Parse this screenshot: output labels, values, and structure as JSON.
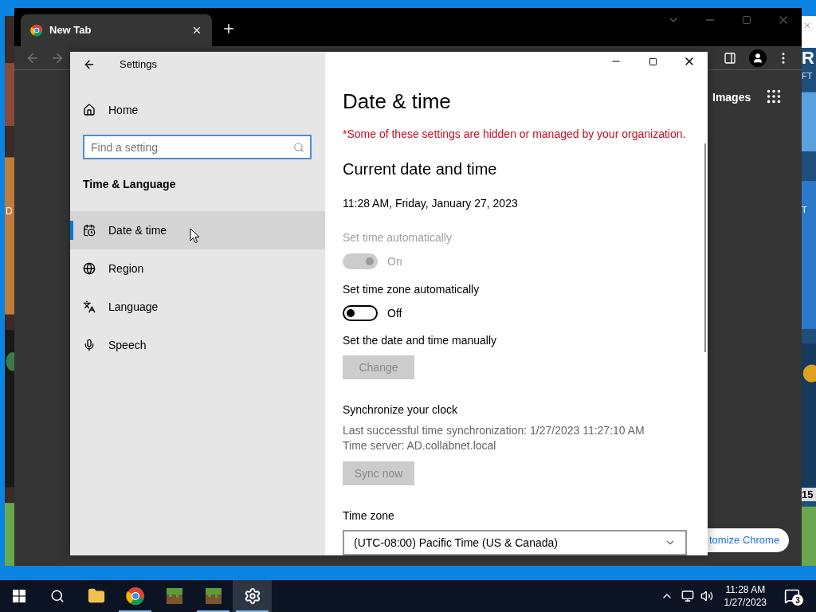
{
  "background_windows": {
    "left_texts": [
      "D"
    ],
    "right_texts": [
      "R",
      "FT",
      "T",
      "15"
    ]
  },
  "browser": {
    "tabs": [
      {
        "title": "New Tab",
        "selected": true
      }
    ],
    "page": {
      "header_link": "Images",
      "customize_button": "tomize Chrome"
    }
  },
  "settings": {
    "window_title": "Settings",
    "sidebar": {
      "home": "Home",
      "search": {
        "placeholder": "Find a setting"
      },
      "section": "Time & Language",
      "items": [
        {
          "label": "Date & time",
          "selected": true
        },
        {
          "label": "Region",
          "selected": false
        },
        {
          "label": "Language",
          "selected": false
        },
        {
          "label": "Speech",
          "selected": false
        }
      ]
    },
    "content": {
      "title": "Date & time",
      "notice": "*Some of these settings are hidden or managed by your organization.",
      "section_title": "Current date and time",
      "current": "11:28 AM, Friday, January 27, 2023",
      "rows": [
        {
          "kind": "toggle",
          "label": "Set time automatically",
          "on": true,
          "disabled": true,
          "state_text": "On"
        },
        {
          "kind": "toggle",
          "label": "Set time zone automatically",
          "on": false,
          "disabled": false,
          "state_text": "Off"
        },
        {
          "kind": "button",
          "label": "Set the date and time manually",
          "lines": [],
          "button": "Change",
          "disabled": true
        },
        {
          "kind": "button",
          "label": "Synchronize your clock",
          "lines": [
            "Last successful time synchronization: 1/27/2023 11:27:10 AM",
            "Time server: AD.collabnet.local"
          ],
          "button": "Sync now",
          "disabled": true
        },
        {
          "kind": "dropdown",
          "label": "Time zone",
          "value": "(UTC-08:00) Pacific Time (US & Canada)"
        }
      ]
    }
  },
  "taskbar": {
    "apps": [
      {
        "running": false,
        "selected": false
      },
      {
        "running": true,
        "selected": false
      },
      {
        "running": false,
        "selected": false
      },
      {
        "running": true,
        "selected": false
      },
      {
        "running": true,
        "selected": true
      }
    ],
    "time": "11:28 AM",
    "date": "1/27/2023",
    "notifications": "3"
  }
}
